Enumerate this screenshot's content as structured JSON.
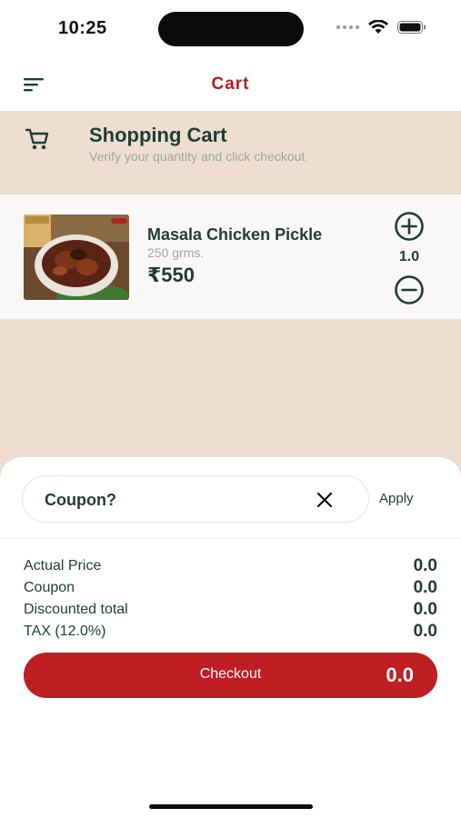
{
  "status_bar": {
    "time": "10:25"
  },
  "nav": {
    "title": "Cart"
  },
  "cart_header": {
    "title": "Shopping Cart",
    "subtitle": "Verify your quantity and click checkout"
  },
  "items": [
    {
      "name": "Masala Chicken Pickle",
      "weight": "250 grms.",
      "price": "₹550",
      "quantity": "1.0"
    }
  ],
  "coupon": {
    "placeholder": "Coupon?",
    "apply_label": "Apply"
  },
  "summary": [
    {
      "label": "Actual Price",
      "value": "0.0"
    },
    {
      "label": "Coupon",
      "value": "0.0"
    },
    {
      "label": "Discounted total",
      "value": "0.0"
    },
    {
      "label": "TAX (12.0%)",
      "value": "0.0"
    }
  ],
  "checkout": {
    "label": "Checkout",
    "total": "0.0"
  },
  "colors": {
    "accent": "#bf1e22",
    "nav_title": "#b81c22",
    "primary_text": "#1f3d33",
    "beige_background": "#eeded0"
  },
  "icons": {
    "menu": "menu-icon",
    "cart": "cart-icon",
    "plus": "plus-circle-icon",
    "minus": "minus-circle-icon",
    "clear": "close-icon",
    "wifi": "wifi-icon",
    "battery": "battery-icon"
  }
}
